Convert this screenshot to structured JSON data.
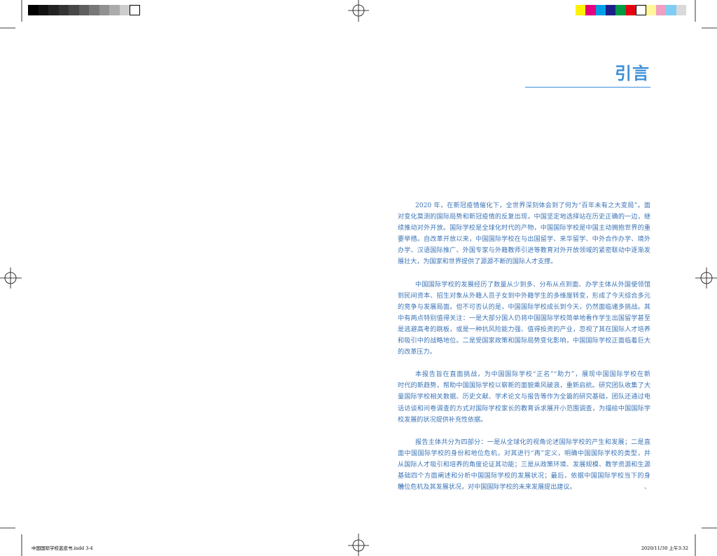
{
  "colors": {
    "accent": "#3d8fd9",
    "body_text": "#3c74b6",
    "footer_text": "#000000"
  },
  "color_bars": {
    "grayscale": [
      "#000000",
      "#111111",
      "#222222",
      "#333333",
      "#474747",
      "#5e5e5e",
      "#777777",
      "#919191",
      "#ababab",
      "#cdcdcd",
      "#ffffff"
    ],
    "process": [
      "#fff100",
      "#e4007f",
      "#00a0e9",
      "#1d2088",
      "#009944",
      "#e60012",
      "#ffffff",
      "#fff799",
      "#f19ec2",
      "#7ecef4",
      "#d9d9d9"
    ]
  },
  "title": "引言",
  "paragraphs": [
    {
      "lines": [
        "2020 年，在新冠疫情催化下，全世界深刻体会到了何为“百年未有之大变局”。面",
        "对变化莫测的国际局势和新冠疫情的反复出现，中国坚定地选择站在历史正确的一边，继",
        "续推动对外开放。国际学校是全球化时代的产物，中国国际学校是中国主动拥抱世界的重",
        "要举措。自改革开放以来，中国国际学校在与出国留学、来华留学、中外合作办学、境外",
        "办学、汉语国际推广、外国专家与外籍教师引进等教育对外开放领域的紧密联动中逐渐发",
        "展壮大，为国家和世界提供了源源不断的国际人才支撑。"
      ]
    },
    {
      "lines": [
        "中国国际学校的发展经历了数量从少到多、分布从点到面、办学主体从外国使领馆",
        "到民间资本、招生对象从外籍人员子女到中外籍学生的多维度转变，形成了今天综合多元",
        "的竞争与发展局面。但不可否认的是，中国国际学校成长到今天，仍然面临诸多挑战。其",
        "中有两点特别值得关注：一是大部分国人仍将中国国际学校简单地看作学生出国留学甚至",
        "是逃避高考的跳板，或是一种抗风险能力强、值得投资的产业，忽视了其在国际人才培养",
        "和吸引中的战略地位。二是受国家政策和国际局势变化影响，中国国际学校正面临着巨大",
        "的改革压力。"
      ]
    },
    {
      "lines": [
        "本报告旨在直面挑战，为中国国际学校“正名”“助力”，展现中国国际学校在新",
        "时代的新趋势，帮助中国国际学校以崭新的面貌乘风破浪，重新启航。研究团队收集了大",
        "量国际学校相关数据、历史文献、学术论文与报告等作为全篇的研究基础，团队还通过电",
        "话访谈和问卷调查的方式对国际学校家长的教育诉求展开小范围调查，为描绘中国国际学",
        "校发展的状况提供补充性依据。"
      ]
    },
    {
      "lines": [
        "报告主体共分为四部分：一是从全球化的视角论述国际学校的产生和发展；二是直",
        "面中国国际学校的身份和地位危机，对其进行“再”定义，明确中国国际学校的类型，并",
        "从国际人才吸引和培养的角度论证其功能；三是从政策环境、发展规模、教学资源和生源",
        "基础四个方面阐述和分析中国国际学校的发展状况；最后，依据中国国际学校当下的身份、",
        "地位危机及其发展状况，对中国国际学校的未来发展提出建议。"
      ]
    }
  ],
  "footer": {
    "file_label": "中国国际学校蓝皮书.indd 3-4",
    "timestamp": "2020/11/30 上午3:32"
  }
}
